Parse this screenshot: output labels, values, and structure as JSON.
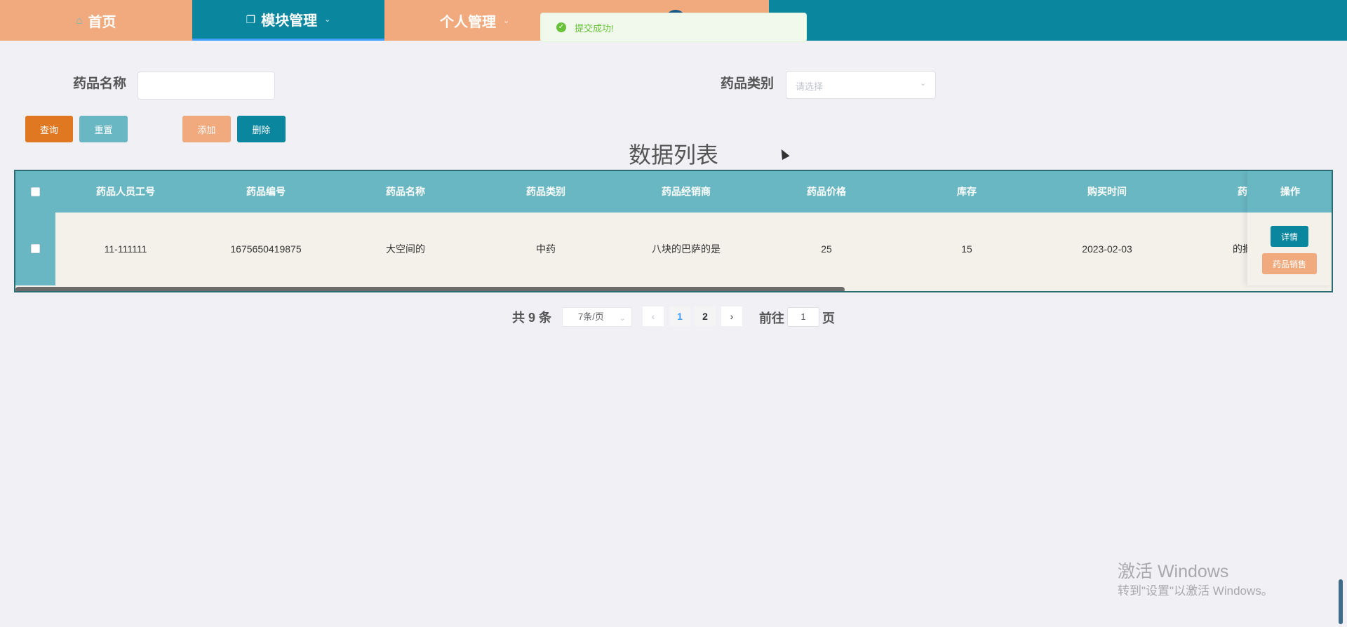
{
  "nav": {
    "home": "首页",
    "module": "模块管理",
    "personal": "个人管理"
  },
  "toast": {
    "message": "提交成功!"
  },
  "search": {
    "name_label": "药品名称",
    "name_value": "",
    "type_label": "药品类别",
    "type_placeholder": "请选择"
  },
  "buttons": {
    "query": "查询",
    "reset": "重置",
    "add": "添加",
    "delete": "删除"
  },
  "list_title": "数据列表",
  "table": {
    "headers": [
      "药品人员工号",
      "药品编号",
      "药品名称",
      "药品类别",
      "药品经销商",
      "药品价格",
      "库存",
      "购买时间",
      "药品"
    ],
    "op_header": "操作",
    "rows": [
      [
        "11-111111",
        "1675650419875",
        "大空间的",
        "中药",
        "八块的巴萨的是",
        "25",
        "15",
        "2023-02-03",
        "的撒女"
      ]
    ],
    "row_actions": {
      "detail": "详情",
      "sell": "药品销售"
    }
  },
  "pagination": {
    "total": "共 9 条",
    "page_size": "7条/页",
    "pages": [
      "1",
      "2"
    ],
    "current": 1,
    "goto_label": "前往",
    "goto_value": "1",
    "page_unit": "页"
  },
  "watermark": {
    "line1": "激活 Windows",
    "line2": "转到\"设置\"以激活 Windows。"
  }
}
